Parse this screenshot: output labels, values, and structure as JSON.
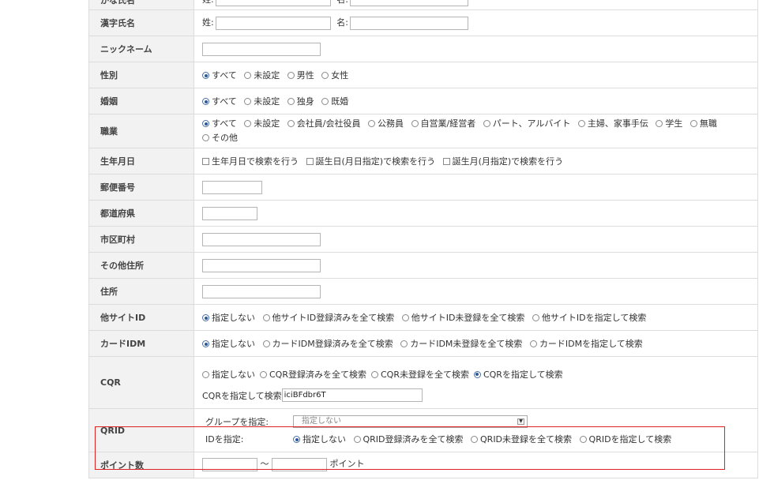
{
  "rows": {
    "kana_name": {
      "label": "かな氏名",
      "last_label": "姓:",
      "first_label": "名:"
    },
    "kanji_name": {
      "label": "漢字氏名",
      "last_label": "姓:",
      "first_label": "名:"
    },
    "nickname": {
      "label": "ニックネーム"
    },
    "gender": {
      "label": "性別",
      "options": [
        "すべて",
        "未設定",
        "男性",
        "女性"
      ],
      "selected": 0
    },
    "marital": {
      "label": "婚姻",
      "options": [
        "すべて",
        "未設定",
        "独身",
        "既婚"
      ],
      "selected": 0
    },
    "occupation": {
      "label": "職業",
      "options": [
        "すべて",
        "未設定",
        "会社員/会社役員",
        "公務員",
        "自営業/経営者",
        "パート、アルバイト",
        "主婦、家事手伝",
        "学生",
        "無職",
        "その他"
      ],
      "selected": 0
    },
    "birthdate": {
      "label": "生年月日",
      "checks": [
        "生年月日で検索を行う",
        "誕生日(月日指定)で検索を行う",
        "誕生月(月指定)で検索を行う"
      ]
    },
    "postal": {
      "label": "郵便番号"
    },
    "prefecture": {
      "label": "都道府県"
    },
    "city": {
      "label": "市区町村"
    },
    "other_address": {
      "label": "その他住所"
    },
    "address": {
      "label": "住所"
    },
    "other_site_id": {
      "label": "他サイトID",
      "options": [
        "指定しない",
        "他サイトID登録済みを全て検索",
        "他サイトID未登録を全て検索",
        "他サイトIDを指定して検索"
      ],
      "selected": 0
    },
    "card_idm": {
      "label": "カードIDM",
      "options": [
        "指定しない",
        "カードIDM登録済みを全て検索",
        "カードIDM未登録を全て検索",
        "カードIDMを指定して検索"
      ],
      "selected": 0
    },
    "cqr": {
      "label": "CQR",
      "options": [
        "指定しない",
        "CQR登録済みを全て検索",
        "CQR未登録を全て検索",
        "CQRを指定して検索"
      ],
      "selected": 3,
      "search_label": "CQRを指定して検索",
      "search_value": "iciBFdbr6T"
    },
    "qrid": {
      "label": "QRID",
      "group_label": "グループを指定:",
      "group_value": "指定しない",
      "id_label": "IDを指定:",
      "options": [
        "指定しない",
        "QRID登録済みを全て検索",
        "QRID未登録を全て検索",
        "QRIDを指定して検索"
      ],
      "selected": 0
    },
    "points": {
      "label": "ポイント数",
      "separator": "～",
      "unit": "ポイント"
    }
  },
  "colors": {
    "highlight": "#dd2222",
    "label_bg": "#f2f2f2",
    "border": "#dcdcdc"
  }
}
